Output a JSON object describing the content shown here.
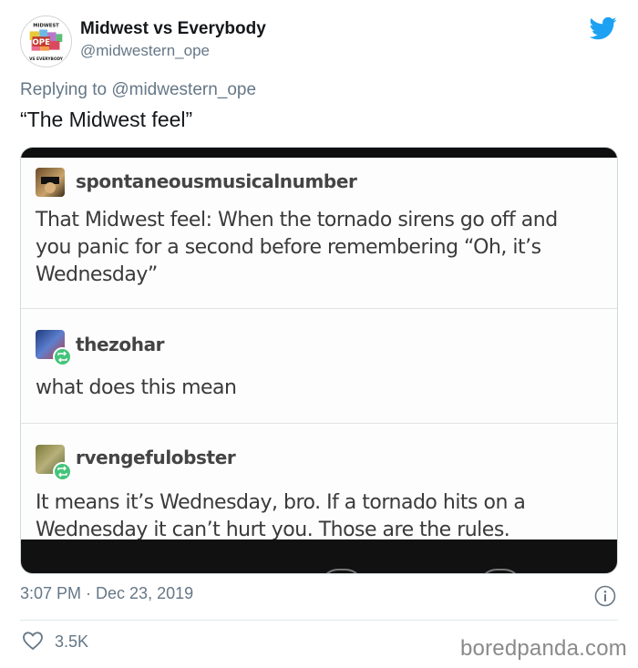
{
  "tweet": {
    "display_name": "Midwest vs Everybody",
    "handle": "@midwestern_ope",
    "replying_prefix": "Replying to",
    "replying_to": "@midwestern_ope",
    "text": "“The Midwest feel”",
    "timestamp": "3:07 PM · Dec 23, 2019",
    "likes": "3.5K"
  },
  "avatar_logo": {
    "top_text": "MIDWEST",
    "center_text": "OPE",
    "bottom_text": "VS EVERYBODY"
  },
  "embedded": {
    "posts": [
      {
        "user": "spontaneousmusicalnumber",
        "lines": [
          "That Midwest feel: When the tornado sirens go off and",
          "you panic for a second before remembering “Oh, it’s",
          "Wednesday”"
        ]
      },
      {
        "user": "thezohar",
        "lines": [
          "what does this mean"
        ]
      },
      {
        "user": "rvengefulobster",
        "lines": [
          "It means it’s Wednesday, bro. If a tornado hits on a",
          "Wednesday it can’t hurt you. Those are the rules."
        ]
      }
    ]
  },
  "watermark": "boredpanda.com",
  "icons": {
    "brand": "twitter-bird-icon",
    "info": "info-icon",
    "like": "heart-icon",
    "reblog": "reblog-icon"
  },
  "colors": {
    "twitter_blue": "#1da1f2",
    "secondary_text": "#657786",
    "reblog_green": "#44c47a"
  }
}
